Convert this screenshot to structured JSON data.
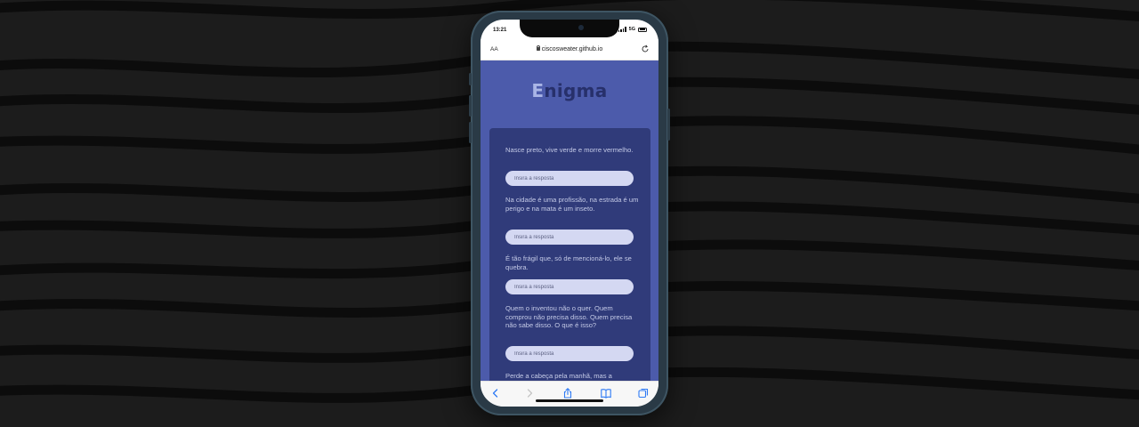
{
  "status_bar": {
    "time": "13:21",
    "network": "5G"
  },
  "browser": {
    "text_size_label": "AA",
    "url": "ciscosweater.github.io"
  },
  "app": {
    "logo_first_letter": "E",
    "logo_rest": "nigma",
    "riddles": [
      {
        "question": "Nasce preto, vive verde e morre vermelho.",
        "placeholder": "Insira a resposta"
      },
      {
        "question": "Na cidade é uma profissão, na estrada é um perigo e na mata é um inseto.",
        "placeholder": "Insira a resposta"
      },
      {
        "question": "É tão frágil que, só de mencioná-lo, ele se quebra.",
        "placeholder": "Insira a resposta"
      },
      {
        "question": "Quem o inventou não o quer. Quem comprou não precisa disso. Quem precisa não sabe disso. O que é isso?",
        "placeholder": "Insira a resposta"
      },
      {
        "question": "Perde a cabeça pela manhã, mas a"
      }
    ]
  },
  "icons": {
    "toolbar": [
      "back-icon",
      "forward-icon",
      "share-icon",
      "bookmarks-icon",
      "tabs-icon"
    ]
  },
  "colors": {
    "background": "#1c1c1c",
    "page": "#4c5bab",
    "card": "#303b7a",
    "input": "#d4d8f2",
    "accent": "#2f7bf5"
  }
}
